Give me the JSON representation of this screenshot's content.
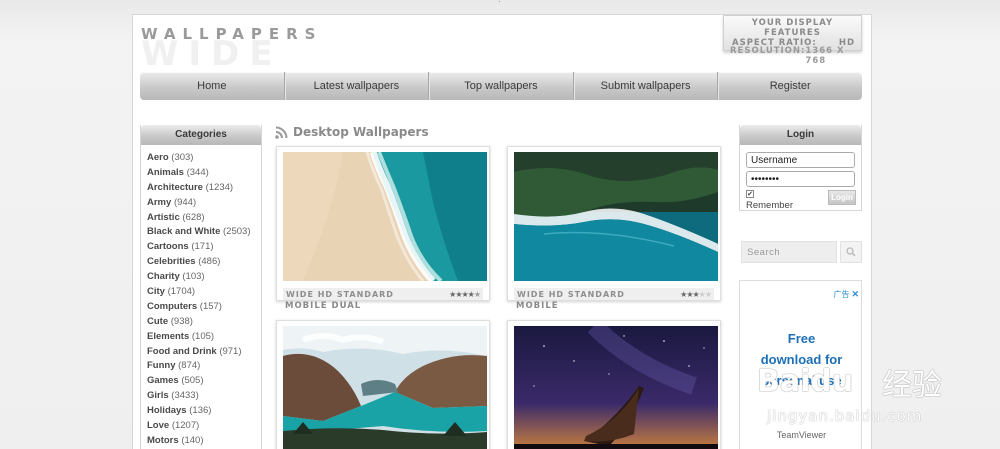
{
  "logo": {
    "top": "WALLPAPERS",
    "big": "WIDE"
  },
  "display": {
    "line1": "YOUR DISPLAY",
    "line2": "FEATURES",
    "aspect_label": "ASPECT RATIO:",
    "aspect_value": "HD",
    "resolution_label": "RESOLUTION:",
    "resolution_value": "1366 X 768"
  },
  "nav": [
    "Home",
    "Latest wallpapers",
    "Top wallpapers",
    "Submit wallpapers",
    "Register"
  ],
  "categories": {
    "title": "Categories",
    "items": [
      {
        "name": "Aero",
        "count": "(303)"
      },
      {
        "name": "Animals",
        "count": "(344)"
      },
      {
        "name": "Architecture",
        "count": "(1234)"
      },
      {
        "name": "Army",
        "count": "(944)"
      },
      {
        "name": "Artistic",
        "count": "(628)"
      },
      {
        "name": "Black and White",
        "count": "(2503)"
      },
      {
        "name": "Cartoons",
        "count": "(171)"
      },
      {
        "name": "Celebrities",
        "count": "(486)"
      },
      {
        "name": "Charity",
        "count": "(103)"
      },
      {
        "name": "City",
        "count": "(1704)"
      },
      {
        "name": "Computers",
        "count": "(157)"
      },
      {
        "name": "Cute",
        "count": "(938)"
      },
      {
        "name": "Elements",
        "count": "(105)"
      },
      {
        "name": "Food and Drink",
        "count": "(971)"
      },
      {
        "name": "Funny",
        "count": "(874)"
      },
      {
        "name": "Games",
        "count": "(505)"
      },
      {
        "name": "Girls",
        "count": "(3433)"
      },
      {
        "name": "Holidays",
        "count": "(136)"
      },
      {
        "name": "Love",
        "count": "(1207)"
      },
      {
        "name": "Motors",
        "count": "(140)"
      }
    ]
  },
  "main": {
    "title": "Desktop Wallpapers",
    "cards": [
      {
        "standard": "WIDE HD STANDARD",
        "rating": 4.5,
        "sub": "MOBILE DUAL"
      },
      {
        "standard": "WIDE HD STANDARD",
        "rating": 3,
        "sub": "MOBILE"
      },
      {
        "standard": "",
        "rating": 0,
        "sub": ""
      },
      {
        "standard": "",
        "rating": 0,
        "sub": ""
      }
    ]
  },
  "login": {
    "title": "Login",
    "username": "Username",
    "password": "••••••••",
    "remember": "Remember",
    "button": "Login"
  },
  "search": {
    "placeholder": "Search"
  },
  "ad": {
    "label": "广告",
    "line1": "Free",
    "line2": "download for",
    "line3": "personal use",
    "brand": "TeamViewer"
  },
  "watermark": {
    "brand": "Baidu",
    "cn": "经验",
    "url": "jingyan.baidu.com"
  }
}
